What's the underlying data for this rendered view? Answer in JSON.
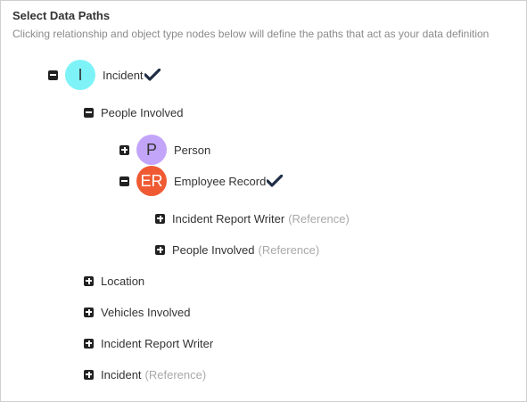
{
  "header": {
    "title": "Select Data Paths",
    "subtitle": "Clicking relationship and object type nodes below will define the paths that act as your data definition"
  },
  "tree": {
    "incident": {
      "avatar": "I",
      "avatar_color": "#7ef3f7",
      "label": "Incident",
      "selected": true,
      "state": "collapse"
    },
    "people_involved": {
      "label": "People Involved",
      "state": "collapse"
    },
    "person": {
      "avatar": "P",
      "avatar_color": "#c2a5f9",
      "label": "Person",
      "state": "expand"
    },
    "employee_record": {
      "avatar": "ER",
      "avatar_color": "#f05a33",
      "label": "Employee Record",
      "selected": true,
      "state": "collapse"
    },
    "er_incident_report_writer": {
      "label": "Incident Report Writer",
      "ref": "(Reference)",
      "state": "expand"
    },
    "er_people_involved": {
      "label": "People Involved",
      "ref": "(Reference)",
      "state": "expand"
    },
    "location": {
      "label": "Location",
      "state": "expand"
    },
    "vehicles_involved": {
      "label": "Vehicles Involved",
      "state": "expand"
    },
    "incident_report_writer": {
      "label": "Incident Report Writer",
      "state": "expand"
    },
    "incident_ref": {
      "label": "Incident",
      "ref": "(Reference)",
      "state": "expand"
    }
  },
  "colors": {
    "check": "#1f2e45",
    "toggle": "#222222",
    "reference_text": "#a9a9a9"
  }
}
